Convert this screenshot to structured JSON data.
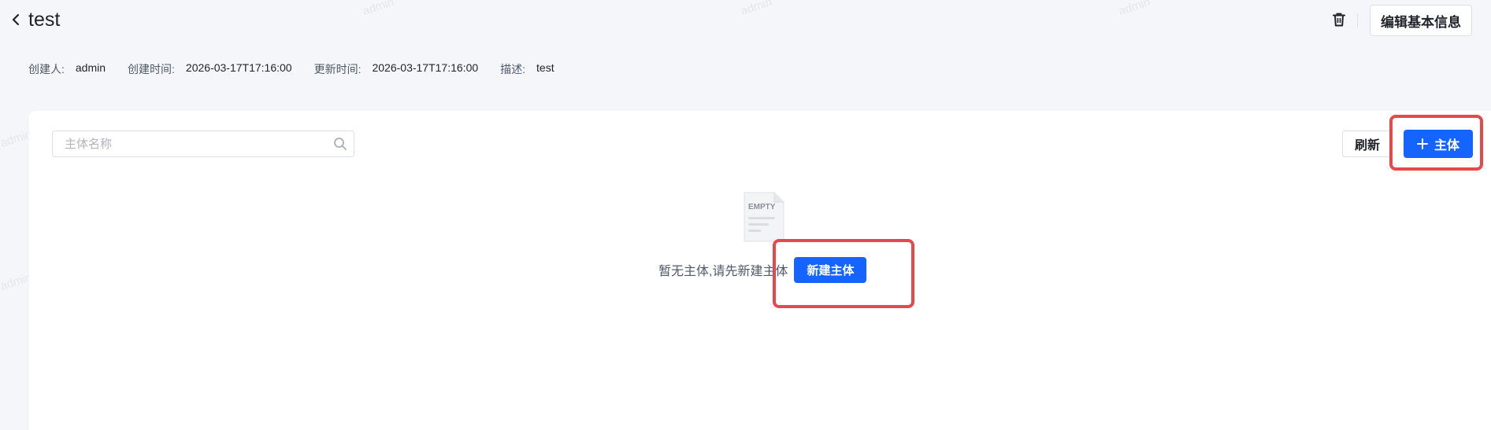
{
  "header": {
    "title": "test",
    "edit_label": "编辑基本信息"
  },
  "meta": {
    "creator_label": "创建人:",
    "creator": "admin",
    "created_label": "创建时间:",
    "created": "2026-03-17T17:16:00",
    "updated_label": "更新时间:",
    "updated": "2026-03-17T17:16:00",
    "desc_label": "描述:",
    "desc": "test"
  },
  "toolbar": {
    "search_placeholder": "主体名称",
    "refresh_label": "刷新",
    "add_label": "主体"
  },
  "empty": {
    "image_text": "EMPTY",
    "message": "暂无主体,请先新建主体",
    "new_label": "新建主体"
  },
  "watermark": "admin",
  "colors": {
    "primary": "#1664ff",
    "highlight": "#e5484d",
    "background": "#f4f6fa"
  }
}
